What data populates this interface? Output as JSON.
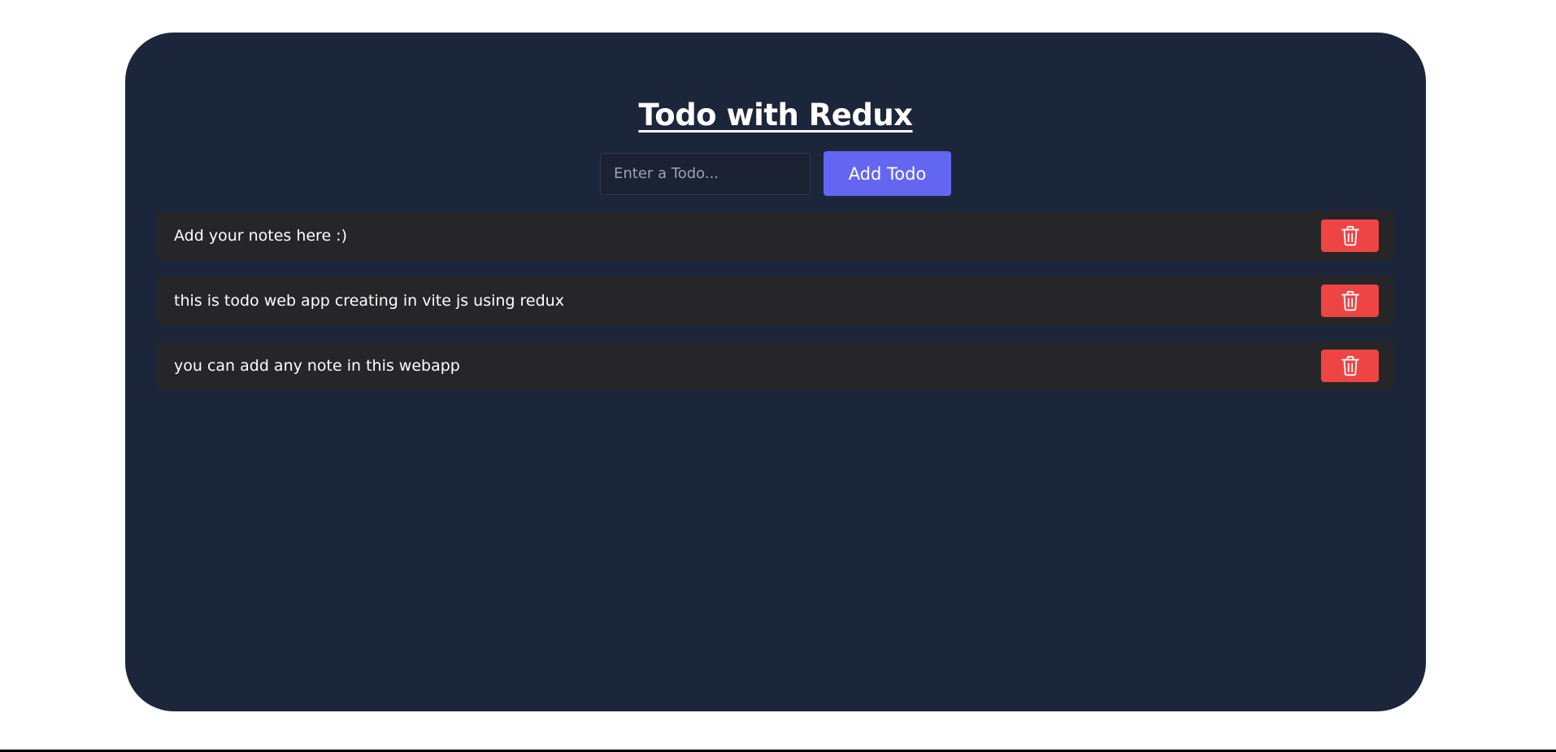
{
  "app": {
    "title": "Todo with Redux"
  },
  "form": {
    "input_value": "",
    "input_placeholder": "Enter a Todo...",
    "add_label": "Add Todo"
  },
  "todos": [
    {
      "text": "Add your notes here :)",
      "action_icon": "trash-icon"
    },
    {
      "text": "this is todo web app creating in vite js using redux",
      "action_icon": "trash-icon"
    },
    {
      "text": "you can add any note in this webapp",
      "action_icon": "trash-icon"
    }
  ],
  "colors": {
    "page_background": "#ffffff",
    "card_background": "#1c263b",
    "item_background": "#262628",
    "add_button": "#6366f1",
    "delete_button": "#ef4444",
    "text": "#ffffff"
  }
}
